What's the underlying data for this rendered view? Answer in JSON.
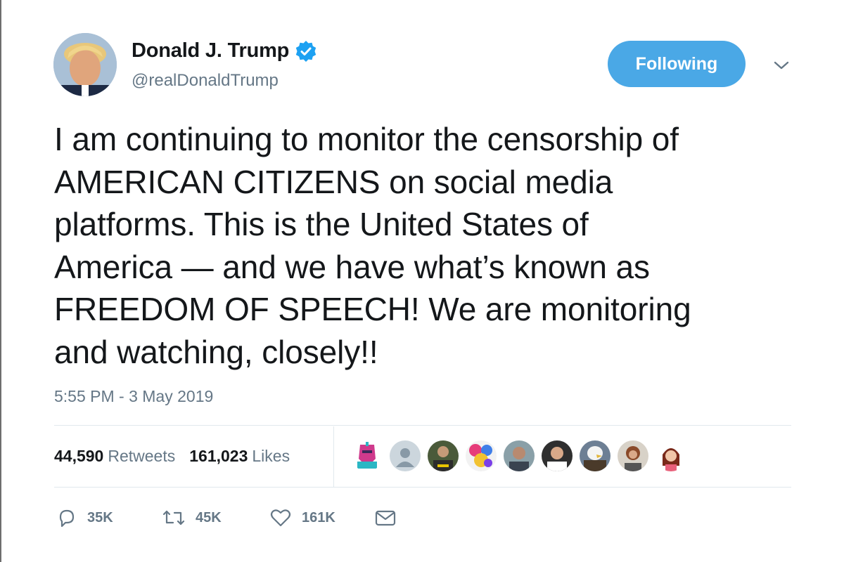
{
  "author": {
    "name": "Donald J. Trump",
    "handle": "@realDonaldTrump",
    "verified_icon": "verified-badge-icon"
  },
  "follow_button": {
    "label": "Following",
    "color": "#4aa8e6"
  },
  "tweet": {
    "text": "I am continuing to monitor the censorship of\nAMERICAN CITIZENS on social media\nplatforms. This is the United States of\nAmerica — and we have what’s known as\nFREEDOM OF SPEECH! We are monitoring\nand watching, closely!!",
    "timestamp": "5:55 PM - 3 May 2019"
  },
  "stats": {
    "retweets_count": "44,590",
    "retweets_label": "Retweets",
    "likes_count": "161,023",
    "likes_label": "Likes"
  },
  "likers": [
    {
      "icon": "knight-avatar"
    },
    {
      "icon": "default-user-avatar"
    },
    {
      "icon": "photo-avatar"
    },
    {
      "icon": "colorful-avatar"
    },
    {
      "icon": "photo-avatar"
    },
    {
      "icon": "photo-avatar"
    },
    {
      "icon": "eagle-avatar"
    },
    {
      "icon": "photo-avatar"
    },
    {
      "icon": "cartoon-avatar"
    }
  ],
  "actions": {
    "reply_count": "35K",
    "retweet_count": "45K",
    "like_count": "161K",
    "dm_icon": "envelope-icon"
  },
  "colors": {
    "text_primary": "#14171a",
    "text_secondary": "#657786",
    "divider": "#e1e8ed",
    "accent": "#1da1f2"
  }
}
